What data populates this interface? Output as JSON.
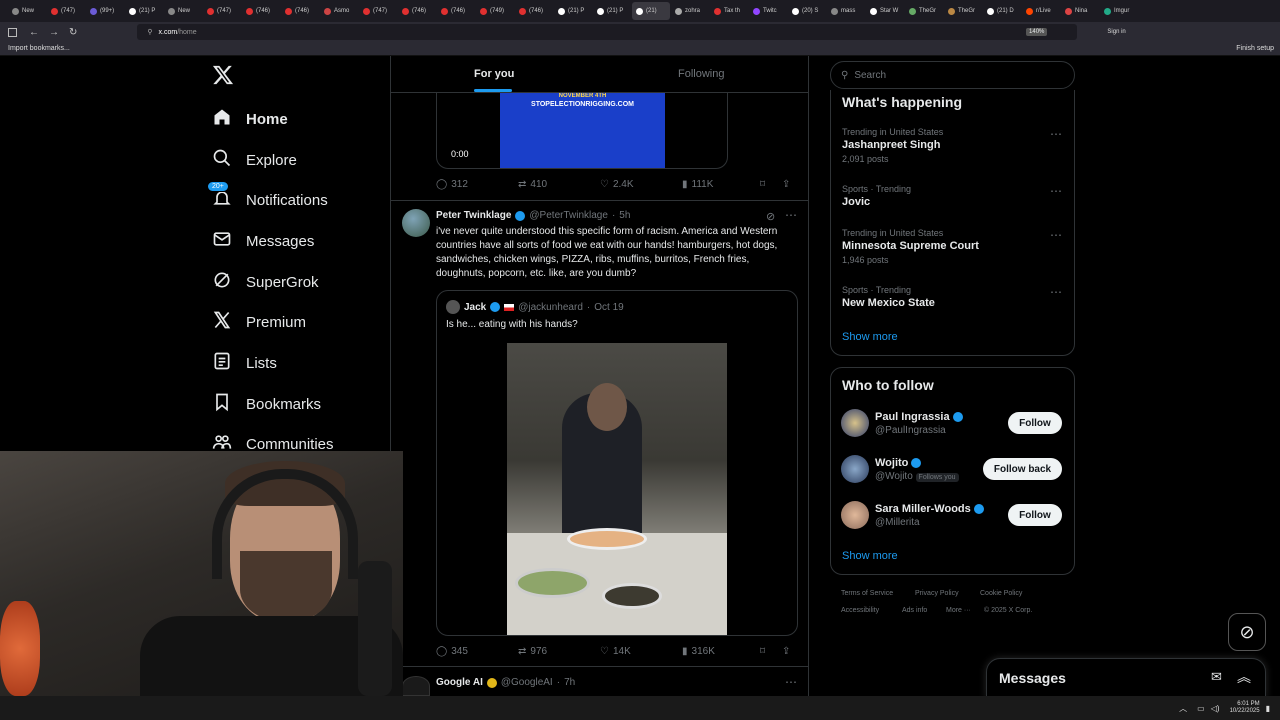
{
  "browser": {
    "tabs": [
      "New",
      "(747)",
      "(99+)",
      "(21) P",
      "New",
      "(747)",
      "(746)",
      "(746)",
      "Asmo",
      "(747)",
      "(746)",
      "(746)",
      "(749)",
      "(746)",
      "(21) P",
      "(21) P",
      "(21)",
      "zohra",
      "Tax th",
      "Twitc",
      "(20) S",
      "mass",
      "Star W",
      "TheGr",
      "TheGr",
      "(21) D",
      "r/Live",
      "Nina",
      "Imgur"
    ],
    "url_host": "x.com",
    "url_path": "/home",
    "zoom": "140%",
    "sign_in": "Sign in",
    "import_bookmarks": "Import bookmarks...",
    "finish_setup": "Finish setup"
  },
  "sidebar": {
    "items": [
      {
        "label": "Home",
        "icon": "home-icon"
      },
      {
        "label": "Explore",
        "icon": "search-icon"
      },
      {
        "label": "Notifications",
        "icon": "bell-icon",
        "badge": "20+"
      },
      {
        "label": "Messages",
        "icon": "mail-icon"
      },
      {
        "label": "SuperGrok",
        "icon": "grok-icon"
      },
      {
        "label": "Premium",
        "icon": "x-logo-icon"
      },
      {
        "label": "Lists",
        "icon": "list-icon"
      },
      {
        "label": "Bookmarks",
        "icon": "bookmark-icon"
      },
      {
        "label": "Communities",
        "icon": "communities-icon"
      }
    ]
  },
  "feed": {
    "tabs": [
      "For you",
      "Following"
    ],
    "video_overlay": {
      "line1": "NOVEMBER 4TH",
      "line2": "STOPELECTIONRIGGING.COM",
      "time": "0:00"
    },
    "first_tweet_stats": {
      "replies": "312",
      "reposts": "410",
      "likes": "2.4K",
      "views": "111K"
    },
    "tweet": {
      "name": "Peter Twinklage",
      "handle": "@PeterTwinklage",
      "time": "5h",
      "text": "i've never quite understood this specific form of racism. America and Western countries have all sorts of food we eat with our hands! hamburgers, hot dogs, sandwiches, chicken wings, PIZZA, ribs, muffins, burritos, French fries, doughnuts, popcorn, etc. like, are you dumb?",
      "quote": {
        "name": "Jack",
        "handle": "@jackunheard",
        "time": "Oct 19",
        "text": "Is he... eating with his hands?"
      },
      "stats": {
        "replies": "345",
        "reposts": "976",
        "likes": "14K",
        "views": "316K"
      }
    },
    "next_tweet": {
      "name": "Google AI",
      "handle": "@GoogleAI",
      "time": "7h"
    }
  },
  "right": {
    "search_placeholder": "Search",
    "whats_happening_title": "What's happening",
    "trends": [
      {
        "meta": "Trending in United States",
        "title": "Jashanpreet Singh",
        "count": "2,091 posts"
      },
      {
        "meta": "Sports · Trending",
        "title": "Jovic",
        "count": ""
      },
      {
        "meta": "Trending in United States",
        "title": "Minnesota Supreme Court",
        "count": "1,946 posts"
      },
      {
        "meta": "Sports · Trending",
        "title": "New Mexico State",
        "count": ""
      }
    ],
    "show_more": "Show more",
    "who_to_follow_title": "Who to follow",
    "follow_suggestions": [
      {
        "name": "Paul Ingrassia",
        "handle": "@PaulIngrassia",
        "button": "Follow",
        "follows_you": ""
      },
      {
        "name": "Wojito",
        "handle": "@Wojito",
        "button": "Follow back",
        "follows_you": "Follows you"
      },
      {
        "name": "Sara Miller-Woods",
        "handle": "@Millerita",
        "button": "Follow",
        "follows_you": ""
      }
    ],
    "footer_links": [
      "Terms of Service",
      "Privacy Policy",
      "Cookie Policy",
      "Accessibility",
      "Ads info",
      "More ···",
      "© 2025 X Corp."
    ]
  },
  "messages_drawer": {
    "title": "Messages"
  },
  "taskbar": {
    "time": "6:01 PM",
    "date": "10/22/2025"
  },
  "colors": {
    "accent": "#1d9bf0",
    "background": "#000000",
    "border": "#2f3336",
    "muted": "#71767b"
  }
}
